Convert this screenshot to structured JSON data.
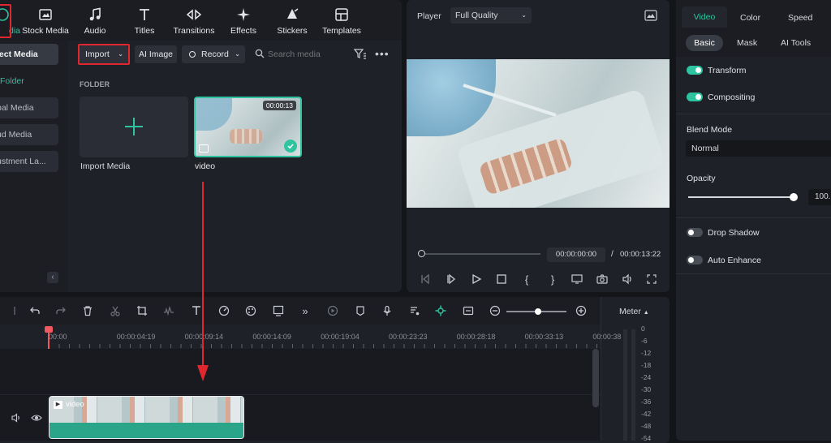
{
  "toolbar": {
    "media": "dia",
    "stock_media": "Stock Media",
    "audio": "Audio",
    "titles": "Titles",
    "transitions": "Transitions",
    "effects": "Effects",
    "stickers": "Stickers",
    "templates": "Templates"
  },
  "sidebar": {
    "project_media": "ject Media",
    "folder": "Folder",
    "global_media": "bal Media",
    "cloud_media": "ud Media",
    "adjustment": "ustment La..."
  },
  "media_bar": {
    "import": "Import",
    "ai_image": "AI Image",
    "record": "Record",
    "search_placeholder": "Search media"
  },
  "media": {
    "folder_heading": "FOLDER",
    "import_label": "Import Media",
    "video_label": "video",
    "video_duration": "00:00:13"
  },
  "player": {
    "label": "Player",
    "quality": "Full Quality",
    "current_time": "00:00:00:00",
    "separator": "/",
    "total_time": "00:00:13:22",
    "progress": 0
  },
  "timeline": {
    "ticks": [
      "00:00",
      "00:00:04:19",
      "00:00:09:14",
      "00:00:14:09",
      "00:00:19:04",
      "00:00:23:23",
      "00:00:28:18",
      "00:00:33:13",
      "00:00:38"
    ],
    "clip_label": "video",
    "meter_label": "Meter",
    "meter_values": [
      "0",
      "-6",
      "-12",
      "-18",
      "-24",
      "-30",
      "-36",
      "-42",
      "-48",
      "-54"
    ]
  },
  "right_panel": {
    "tabs": [
      "Video",
      "Color",
      "Speed"
    ],
    "subtabs": [
      "Basic",
      "Mask",
      "AI Tools"
    ],
    "transform": "Transform",
    "compositing": "Compositing",
    "blend_mode_label": "Blend Mode",
    "blend_mode_value": "Normal",
    "opacity_label": "Opacity",
    "opacity_value": "100.",
    "drop_shadow": "Drop Shadow",
    "auto_enhance": "Auto Enhance"
  },
  "colors": {
    "accent": "#2ec4a0",
    "highlight": "#e0272f",
    "panel": "#1f2128"
  }
}
